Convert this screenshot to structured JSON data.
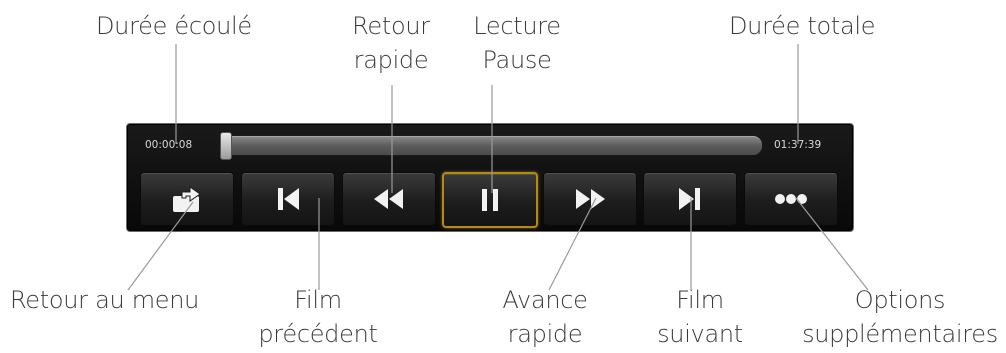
{
  "player": {
    "elapsed": "00:00:08",
    "total": "01:37:39",
    "progress_fraction": 0.0014,
    "accent_color": "#b58a12"
  },
  "annotations": {
    "elapsed_label": "Durée écoulé",
    "rewind_label": [
      "Retour",
      "rapide"
    ],
    "playpause_label": [
      "Lecture",
      "Pause"
    ],
    "total_label": "Durée totale",
    "back_menu_label": "Retour au menu",
    "prev_label": [
      "Film",
      "précédent"
    ],
    "forward_label": [
      "Avance",
      "rapide"
    ],
    "next_label": [
      "Film",
      "suivant"
    ],
    "options_label": [
      "Options",
      "supplémentaires"
    ]
  },
  "buttons": [
    {
      "name": "back-to-menu-button",
      "icon": "return-menu-icon"
    },
    {
      "name": "previous-film-button",
      "icon": "skip-previous-icon"
    },
    {
      "name": "rewind-button",
      "icon": "rewind-icon"
    },
    {
      "name": "play-pause-button",
      "icon": "pause-icon",
      "active": true
    },
    {
      "name": "fast-forward-button",
      "icon": "fast-forward-icon"
    },
    {
      "name": "next-film-button",
      "icon": "skip-next-icon"
    },
    {
      "name": "more-options-button",
      "icon": "more-dots-icon"
    }
  ]
}
